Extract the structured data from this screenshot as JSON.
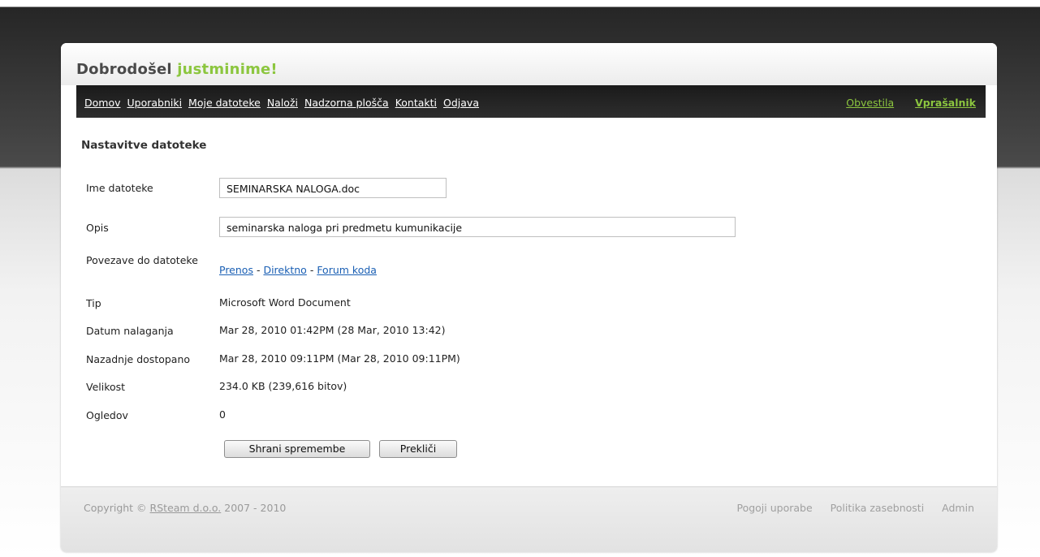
{
  "header": {
    "welcome_prefix": "Dobrodošel",
    "username": "justminime!"
  },
  "nav": {
    "left": [
      "Domov",
      "Uporabniki",
      "Moje datoteke",
      "Naloži",
      "Nadzorna plošča",
      "Kontakti",
      "Odjava"
    ],
    "notifications": "Obvestila",
    "questionnaire": "Vprašalnik"
  },
  "section_title": "Nastavitve datoteke",
  "form": {
    "filename_label": "Ime datoteke",
    "filename_value": "SEMINARSKA NALOGA.doc",
    "description_label": "Opis",
    "description_value": "seminarska naloga pri predmetu kumunikacije",
    "links_label": "Povezave do datoteke",
    "links": [
      "Prenos",
      "Direktno",
      "Forum koda"
    ],
    "link_separator": "-",
    "type_label": "Tip",
    "type_value": "Microsoft Word Document",
    "uploaded_label": "Datum nalaganja",
    "uploaded_value": "Mar 28, 2010 01:42PM (28 Mar, 2010 13:42)",
    "accessed_label": "Nazadnje dostopano",
    "accessed_value": "Mar 28, 2010 09:11PM (Mar 28, 2010 09:11PM)",
    "size_label": "Velikost",
    "size_value": "234.0 KB (239,616 bitov)",
    "views_label": "Ogledov",
    "views_value": "0",
    "save_button": "Shrani spremembe",
    "cancel_button": "Prekliči"
  },
  "footer": {
    "copyright_prefix": "Copyright ©",
    "company": "RSteam d.o.o.",
    "years": "2007 - 2010",
    "links": [
      "Pogoji uporabe",
      "Politika zasebnosti",
      "Admin"
    ]
  },
  "colors": {
    "accent_green": "#8cc63f",
    "link_blue": "#1a5fb4",
    "navbar_bg": "#1a1a1a"
  }
}
